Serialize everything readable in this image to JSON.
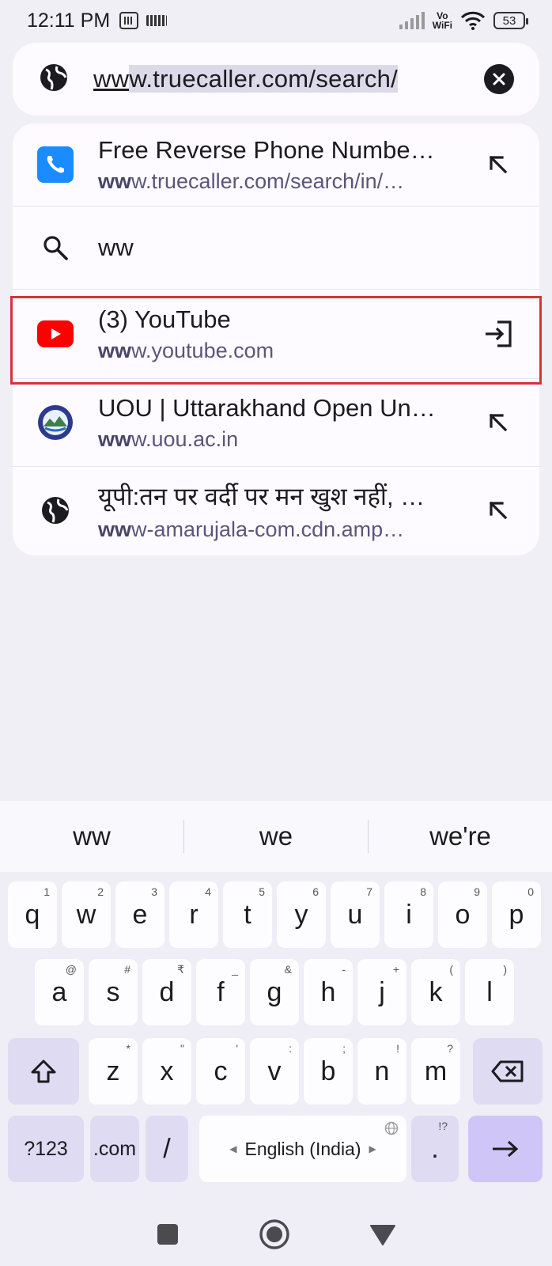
{
  "status_bar": {
    "time": "12:11 PM",
    "vowifi_top": "Vo",
    "vowifi_bottom": "WiFi",
    "battery": "53"
  },
  "url_bar": {
    "typed": "ww",
    "autocompleted": "w.truecaller.com/search/",
    "leading_icon": "globe-icon",
    "clear_icon": "close-icon"
  },
  "suggestions": [
    {
      "title": "Free Reverse Phone Numbe…",
      "url_bold": "ww",
      "url_rest": "w.truecaller.com/search/in/…",
      "icon": "phone-app-icon",
      "action_icon": "arrow-up-left-icon"
    },
    {
      "title": "ww",
      "icon": "search-icon"
    },
    {
      "title": "(3) YouTube",
      "url_bold": "ww",
      "url_rest": "w.youtube.com",
      "icon": "youtube-icon",
      "action_icon": "switch-to-tab-icon"
    },
    {
      "title": "UOU | Uttarakhand Open Un…",
      "url_bold": "ww",
      "url_rest": "w.uou.ac.in",
      "icon": "uou-logo-icon",
      "action_icon": "arrow-up-left-icon"
    },
    {
      "title": "यूपी:तन पर वर्दी पर मन खुश नहीं, …",
      "url_bold": "ww",
      "url_rest": "w-amarujala-com.cdn.amp…",
      "icon": "globe-icon",
      "action_icon": "arrow-up-left-icon"
    }
  ],
  "keyboard": {
    "word_suggestions": [
      "ww",
      "we",
      "we're"
    ],
    "row1": [
      {
        "label": "q",
        "hint": "1"
      },
      {
        "label": "w",
        "hint": "2"
      },
      {
        "label": "e",
        "hint": "3"
      },
      {
        "label": "r",
        "hint": "4"
      },
      {
        "label": "t",
        "hint": "5"
      },
      {
        "label": "y",
        "hint": "6"
      },
      {
        "label": "u",
        "hint": "7"
      },
      {
        "label": "i",
        "hint": "8"
      },
      {
        "label": "o",
        "hint": "9"
      },
      {
        "label": "p",
        "hint": "0"
      }
    ],
    "row2": [
      {
        "label": "a",
        "hint": "@"
      },
      {
        "label": "s",
        "hint": "#"
      },
      {
        "label": "d",
        "hint": "₹"
      },
      {
        "label": "f",
        "hint": "_"
      },
      {
        "label": "g",
        "hint": "&"
      },
      {
        "label": "h",
        "hint": "-"
      },
      {
        "label": "j",
        "hint": "+"
      },
      {
        "label": "k",
        "hint": "("
      },
      {
        "label": "l",
        "hint": ")"
      }
    ],
    "row3": [
      {
        "label": "z",
        "hint": "*"
      },
      {
        "label": "x",
        "hint": "\""
      },
      {
        "label": "c",
        "hint": "'"
      },
      {
        "label": "v",
        "hint": ":"
      },
      {
        "label": "b",
        "hint": ";"
      },
      {
        "label": "n",
        "hint": "!"
      },
      {
        "label": "m",
        "hint": "?"
      }
    ],
    "symbols": "?123",
    "dotcom": ".com",
    "slash": "/",
    "space": "English (India)",
    "period": ".",
    "period_hint": "!?"
  }
}
